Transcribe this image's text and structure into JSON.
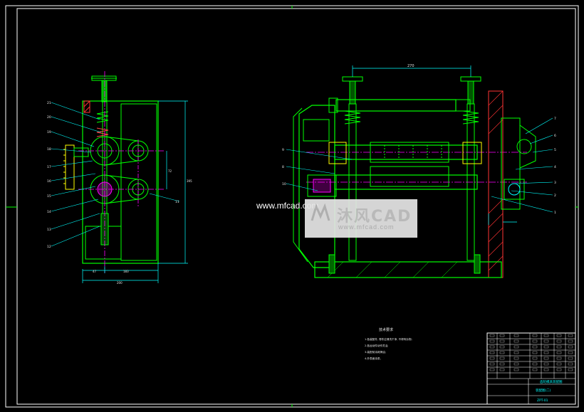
{
  "colors": {
    "background": "#000000",
    "frame": "#ffffff",
    "part": "#00ff00",
    "dimension": "#00ffff",
    "centerline": "#ff00ff",
    "leader": "#00ffff",
    "hatch": "#ff3333",
    "accent": "#ffff00"
  },
  "watermark": {
    "site": "www.mfcad.com",
    "brand": "沐风CAD",
    "url": "www.mfcad.com"
  },
  "left_view": {
    "balloons": [
      "21",
      "20",
      "19",
      "18",
      "17",
      "16",
      "15",
      "14",
      "13",
      "12"
    ],
    "right_balloon": "11"
  },
  "right_view": {
    "balloons_left": [
      "9",
      "8",
      "10"
    ],
    "balloons_right": [
      "7",
      "6",
      "5",
      "4",
      "3",
      "2",
      "1"
    ],
    "top_dimension": "270"
  },
  "notes": {
    "title": "技术要求",
    "lines": [
      "1.各装配件, 零件应清洗干净, 不得有杂物;",
      "2.各运动件动作灵活;",
      "3.装配前涂润滑油;",
      "4.外表面涂漆。"
    ]
  },
  "title_block": {
    "name": "齿轮模具装配图",
    "sub": "装配图(二)",
    "code": "ZPT-01"
  }
}
